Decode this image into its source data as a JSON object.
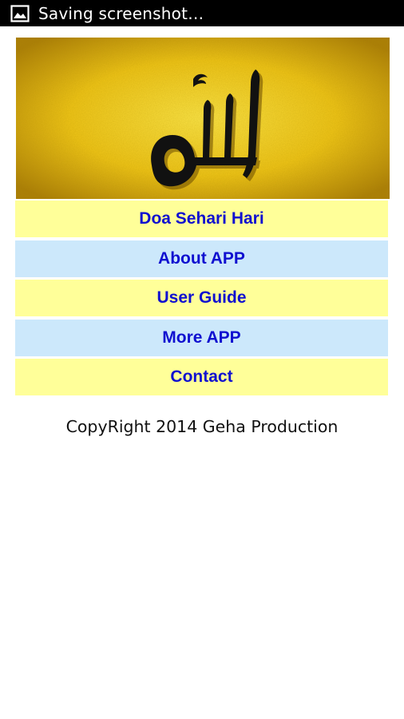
{
  "status_bar": {
    "notification_icon": "image-icon",
    "text": "Saving screenshot…"
  },
  "banner": {
    "image": "allah-calligraphy-banner",
    "background_color": "#e3b70f"
  },
  "menu": {
    "items": [
      {
        "label": "Doa Sehari Hari",
        "color": "#ffff99"
      },
      {
        "label": "About APP",
        "color": "#cce8fb"
      },
      {
        "label": "User Guide",
        "color": "#ffff99"
      },
      {
        "label": "More APP",
        "color": "#cce8fb"
      },
      {
        "label": "Contact",
        "color": "#ffff99"
      }
    ],
    "text_color": "#1010d0"
  },
  "footer": {
    "copyright": "CopyRight 2014 Geha Production"
  }
}
